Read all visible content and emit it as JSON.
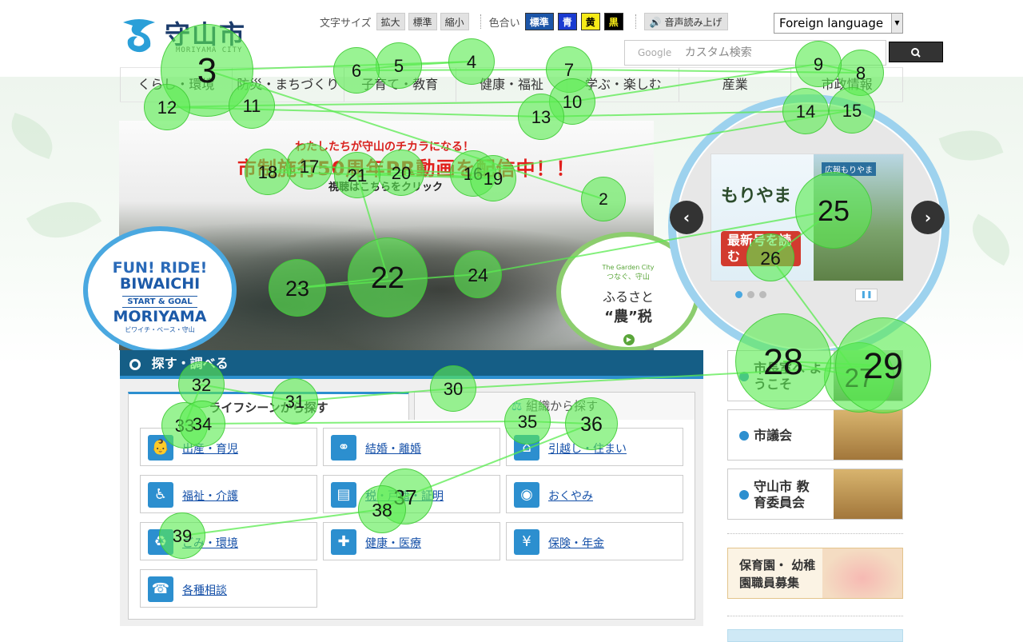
{
  "header": {
    "logo_title": "守山市",
    "logo_subtitle": "MORIYAMA CITY",
    "font_size_label": "文字サイズ",
    "font_size_buttons": [
      "拡大",
      "標準",
      "縮小"
    ],
    "color_label": "色合い",
    "color_buttons": [
      {
        "label": "標準",
        "bg": "#1d56a8",
        "fg": "#ffffff"
      },
      {
        "label": "青",
        "bg": "#1a3bd1",
        "fg": "#ffffff"
      },
      {
        "label": "黄",
        "bg": "#f6ea18",
        "fg": "#000000"
      },
      {
        "label": "黒",
        "bg": "#000000",
        "fg": "#f6ea18"
      }
    ],
    "voice_button": "音声読み上げ",
    "language_select": "Foreign language",
    "search_brand": "Google",
    "search_placeholder": "カスタム検索"
  },
  "nav": [
    "くらし・環境",
    "防災・まちづくり",
    "子育て・教育",
    "健康・福祉",
    "学ぶ・楽しむ",
    "産業",
    "市政情報"
  ],
  "hero": {
    "line1": "わたしたちが守山のチカラになる！",
    "line2": "市制施行50周年PR動画を配信中！！",
    "line3": "視聴はこちらをクリック"
  },
  "biwaichi": {
    "line1": "FUN! RIDE!",
    "line2": "BIWAICHI",
    "line3": "START & GOAL",
    "line4": "MORIYAMA",
    "line5": "ビワイチ・ベース・守山"
  },
  "furusato": {
    "line1": "The Garden City",
    "line2": "つなぐ、守山",
    "line3": "ふるさと",
    "line4": "“農”税"
  },
  "carousel": {
    "title": "もりやま",
    "tag": "広報もりやま",
    "button": "最新号を読む",
    "prev": "‹",
    "next": "›",
    "pause": "❚❚"
  },
  "side_banners": [
    {
      "label": "市長室へ ようこそ"
    },
    {
      "label": "市議会"
    },
    {
      "label": "守山市 教育委員会"
    }
  ],
  "recruit_banner": "保育園・ 幼稚園職員募集",
  "find": {
    "title": "探す・調べる",
    "tab_life": "ライフシーンから探す",
    "tab_org": "組織から探す",
    "categories": [
      {
        "label": "出産・育児",
        "icon": "stroller-icon"
      },
      {
        "label": "結婚・離婚",
        "icon": "couple-icon"
      },
      {
        "label": "引越し・住まい",
        "icon": "house-icon"
      },
      {
        "label": "福祉・介護",
        "icon": "wheelchair-icon"
      },
      {
        "label": "税・戸籍・証明",
        "icon": "document-icon"
      },
      {
        "label": "おくやみ",
        "icon": "portrait-icon"
      },
      {
        "label": "ごみ・環境",
        "icon": "trash-icon"
      },
      {
        "label": "健康・医療",
        "icon": "medical-cross-icon"
      },
      {
        "label": "保険・年金",
        "icon": "money-bag-icon"
      },
      {
        "label": "各種相談",
        "icon": "consultation-icon"
      }
    ]
  },
  "gaze": {
    "color": "#5aeb50",
    "fixation_labels": [
      "2",
      "3",
      "4",
      "5",
      "6",
      "7",
      "8",
      "9",
      "10",
      "11",
      "12",
      "13",
      "14",
      "15",
      "16",
      "17",
      "18",
      "19",
      "20",
      "21",
      "22",
      "23",
      "24",
      "25",
      "26",
      "27",
      "28",
      "29",
      "30",
      "31",
      "32",
      "33",
      "34",
      "35",
      "36",
      "37",
      "38",
      "39"
    ]
  }
}
